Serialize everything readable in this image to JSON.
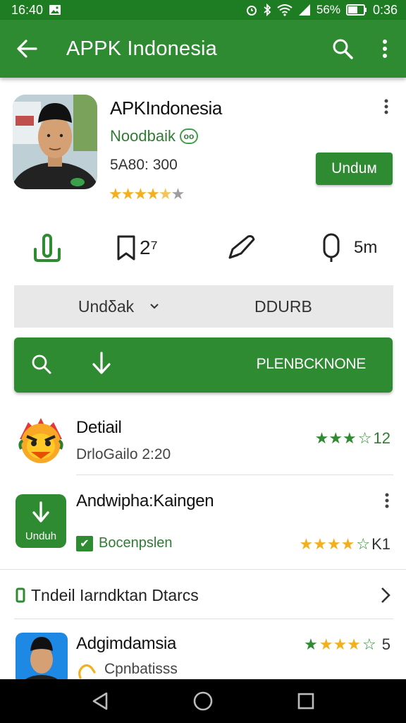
{
  "status_bar": {
    "time_left": "16:40",
    "battery": "56%",
    "time_right": "0:36"
  },
  "app_bar": {
    "title": "APPK Indonesia",
    "icons": [
      "back-arrow-icon",
      "search-icon",
      "more-vert-icon"
    ]
  },
  "app": {
    "name": "APKIndonesia",
    "developer": "Noodbaik",
    "developer_badge": "oo",
    "meta": "5A80: 300",
    "rating_stars": 4.5,
    "install_label": "Unduм"
  },
  "icon_row": {
    "items": [
      {
        "icon": "download-icon",
        "label": ""
      },
      {
        "icon": "bookmark-icon",
        "label": "2⁷"
      },
      {
        "icon": "pen-icon",
        "label": ""
      },
      {
        "icon": "phone-icon",
        "label": "5m"
      }
    ]
  },
  "filter_bar": {
    "left_label": "Undδak",
    "right_label": "DDURB"
  },
  "green_bar": {
    "label": "PLENBCKNONE"
  },
  "list": [
    {
      "title": "Detiail",
      "subtitle": "DrloGailo 2:20",
      "rating_count": "12",
      "stars": 3.5
    },
    {
      "title": "Andwipha:Kaingen",
      "icon_label": "Unduh",
      "verified_label": "Bocenpslen",
      "rating_count": "K1",
      "stars": 4.5
    },
    {
      "title": "Adgimdamsia",
      "subtitle": "Cpnbatisss",
      "rating_count": "5",
      "stars": 4.5
    }
  ],
  "link_row": {
    "label": "Tndeil Iarndktan Dtarcs"
  },
  "colors": {
    "primary": "#2e8b32",
    "status": "#1e7d22",
    "star_gold": "#f2b01e"
  }
}
